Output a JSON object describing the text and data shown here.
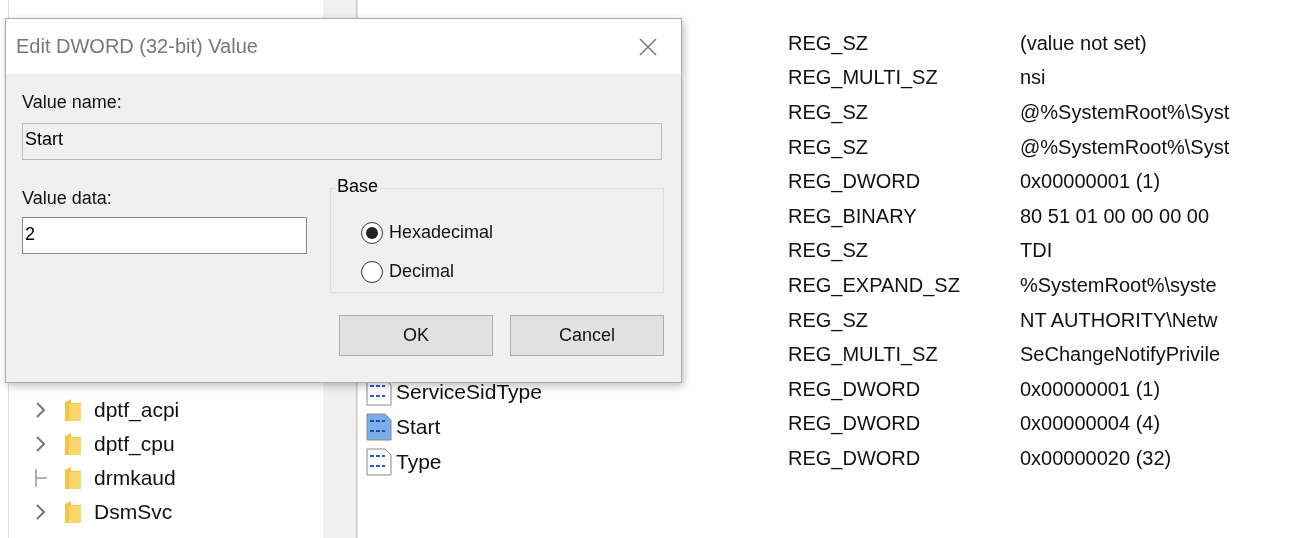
{
  "tree": {
    "items": [
      {
        "label": "dptf_acpi",
        "expandable": true
      },
      {
        "label": "dptf_cpu",
        "expandable": true
      },
      {
        "label": "drmkaud",
        "expandable": false
      },
      {
        "label": "DsmSvc",
        "expandable": true
      }
    ]
  },
  "values": [
    {
      "name": "ServiceSidType",
      "selected": false
    },
    {
      "name": "Start",
      "selected": true
    },
    {
      "name": "Type",
      "selected": false
    }
  ],
  "dialog": {
    "title": "Edit DWORD (32-bit) Value",
    "value_name_label": "Value name:",
    "value_name": "Start",
    "value_data_label": "Value data:",
    "value_data": "2",
    "base": {
      "label": "Base",
      "options": [
        {
          "label": "Hexadecimal",
          "selected": true
        },
        {
          "label": "Decimal",
          "selected": false
        }
      ]
    },
    "buttons": [
      "OK",
      "Cancel"
    ]
  },
  "registry_rows": [
    {
      "type": "REG_SZ",
      "data": "(value not set)"
    },
    {
      "type": "REG_MULTI_SZ",
      "data": "nsi"
    },
    {
      "type": "REG_SZ",
      "data": "@%SystemRoot%\\Syst"
    },
    {
      "type": "REG_SZ",
      "data": "@%SystemRoot%\\Syst"
    },
    {
      "type": "REG_DWORD",
      "data": "0x00000001 (1)"
    },
    {
      "type": "REG_BINARY",
      "data": "80 51 01 00 00 00 00"
    },
    {
      "type": "REG_SZ",
      "data": "TDI"
    },
    {
      "type": "REG_EXPAND_SZ",
      "data": "%SystemRoot%\\syste"
    },
    {
      "type": "REG_SZ",
      "data": "NT AUTHORITY\\Netw"
    },
    {
      "type": "REG_MULTI_SZ",
      "data": "SeChangeNotifyPrivile"
    },
    {
      "type": "REG_DWORD",
      "data": "0x00000001 (1)"
    },
    {
      "type": "REG_DWORD",
      "data": "0x00000004 (4)"
    },
    {
      "type": "REG_DWORD",
      "data": "0x00000020 (32)"
    }
  ]
}
